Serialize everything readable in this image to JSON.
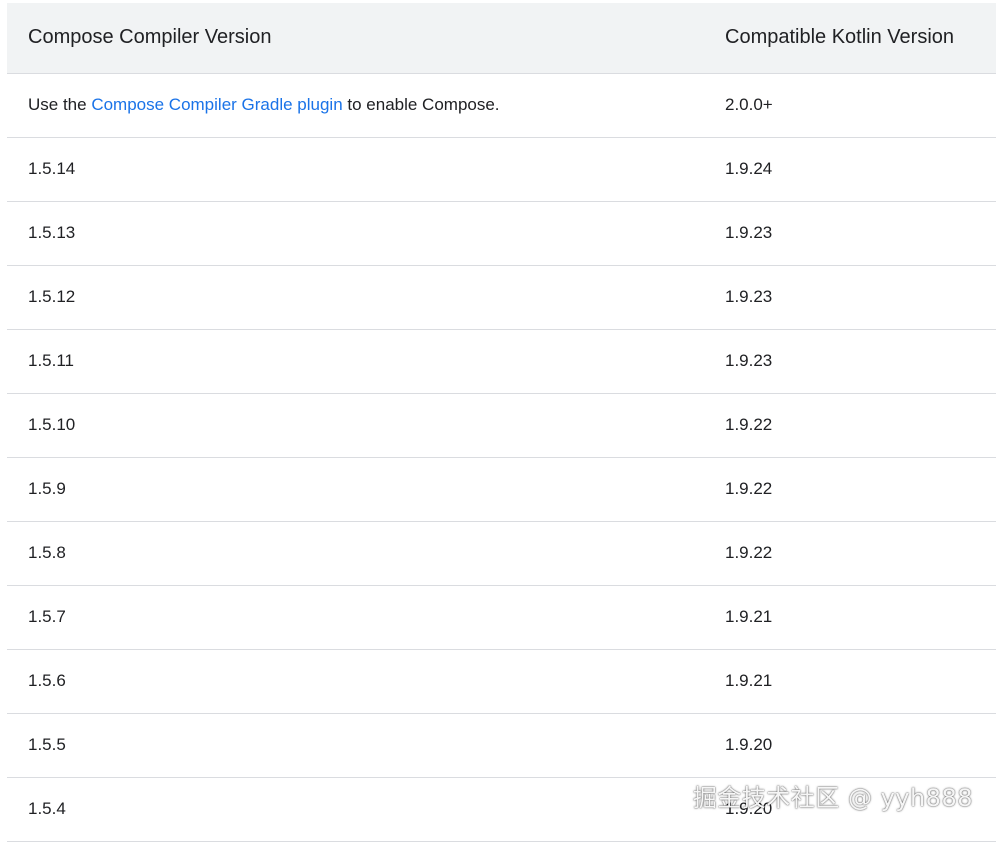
{
  "table": {
    "headers": [
      "Compose Compiler Version",
      "Compatible Kotlin Version"
    ],
    "first_row": {
      "prefix": "Use the ",
      "link_text": "Compose Compiler Gradle plugin",
      "suffix": " to enable Compose.",
      "kotlin": "2.0.0+"
    },
    "rows": [
      {
        "compiler": "1.5.14",
        "kotlin": "1.9.24"
      },
      {
        "compiler": "1.5.13",
        "kotlin": "1.9.23"
      },
      {
        "compiler": "1.5.12",
        "kotlin": "1.9.23"
      },
      {
        "compiler": "1.5.11",
        "kotlin": "1.9.23"
      },
      {
        "compiler": "1.5.10",
        "kotlin": "1.9.22"
      },
      {
        "compiler": "1.5.9",
        "kotlin": "1.9.22"
      },
      {
        "compiler": "1.5.8",
        "kotlin": "1.9.22"
      },
      {
        "compiler": "1.5.7",
        "kotlin": "1.9.21"
      },
      {
        "compiler": "1.5.6",
        "kotlin": "1.9.21"
      },
      {
        "compiler": "1.5.5",
        "kotlin": "1.9.20"
      },
      {
        "compiler": "1.5.4",
        "kotlin": "1.9.20"
      }
    ]
  },
  "watermark": "掘金技术社区 @ yyh888",
  "colors": {
    "header_bg": "#f1f3f4",
    "link": "#1a73e8",
    "divider": "#dadce0",
    "text": "#202124"
  }
}
